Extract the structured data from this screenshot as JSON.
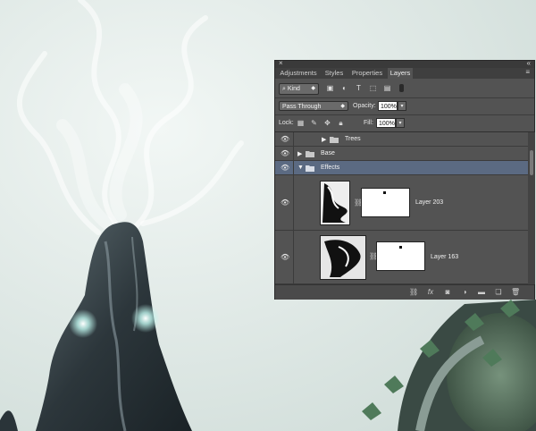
{
  "panel": {
    "title_icons": {
      "close": "×",
      "collapse": "«"
    },
    "tabs": [
      {
        "label": "Adjustments",
        "active": false
      },
      {
        "label": "Styles",
        "active": false
      },
      {
        "label": "Properties",
        "active": false
      },
      {
        "label": "Layers",
        "active": true
      }
    ],
    "tab_menu_icon": "≡",
    "filter": {
      "kind_label": "Kind",
      "filter_icons": [
        "image-filter-icon",
        "adjustment-filter-icon",
        "type-filter-icon",
        "shape-filter-icon",
        "smart-object-filter-icon",
        "filter-toggle-icon"
      ]
    },
    "blend_mode": "Pass Through",
    "opacity_label": "Opacity:",
    "opacity_value": "100%",
    "lock_label": "Lock:",
    "fill_label": "Fill:",
    "fill_value": "100%",
    "layers": [
      {
        "name": "Trees",
        "type": "group",
        "expanded": false,
        "indent": 1,
        "selected": false
      },
      {
        "name": "Base",
        "type": "group",
        "expanded": false,
        "indent": 0,
        "selected": false
      },
      {
        "name": "Effects",
        "type": "group",
        "expanded": true,
        "indent": 0,
        "selected": true
      },
      {
        "name": "Layer 203",
        "type": "layer",
        "has_mask": true,
        "selected": false
      },
      {
        "name": "Layer 163",
        "type": "layer",
        "has_mask": true,
        "selected": false
      }
    ],
    "footer_icons": [
      "link-layers-icon",
      "fx-icon",
      "add-mask-icon",
      "adjustment-layer-icon",
      "new-group-icon",
      "new-layer-icon",
      "delete-icon"
    ],
    "fx_label": "fx"
  },
  "colors": {
    "panel_bg": "#535353",
    "selection": "#5b6a82",
    "canvas_bg": "#dfe9e6"
  }
}
